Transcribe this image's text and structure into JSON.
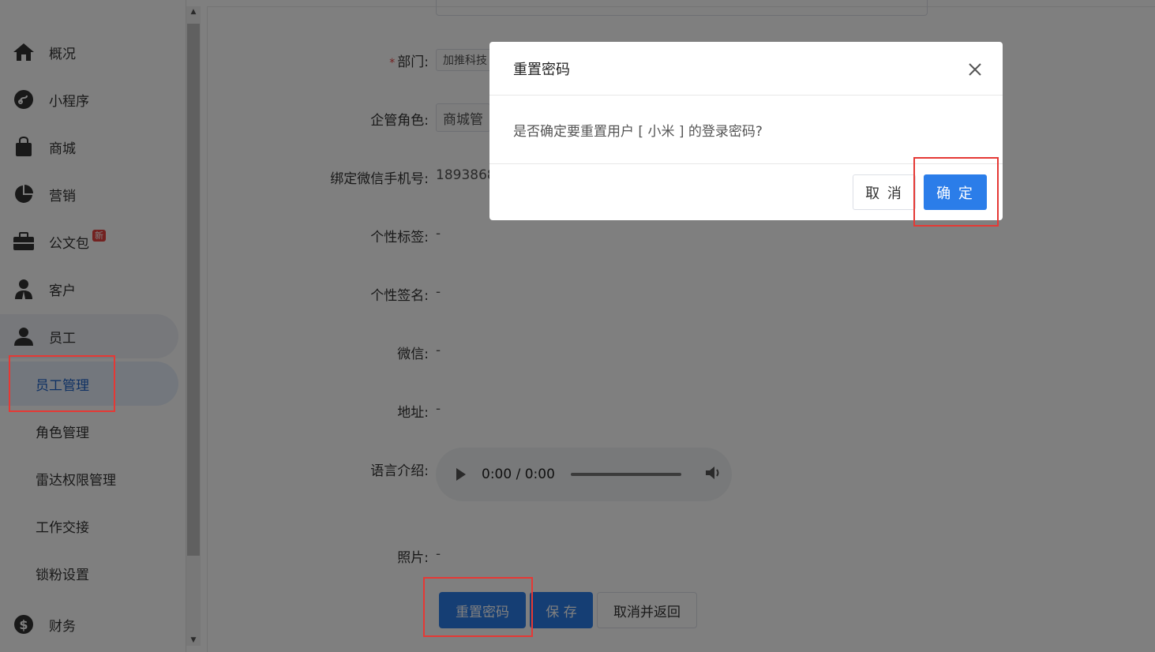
{
  "sidebar": {
    "items": [
      {
        "label": "概况",
        "icon": "home-icon"
      },
      {
        "label": "小程序",
        "icon": "mini-program-icon"
      },
      {
        "label": "商城",
        "icon": "shopping-bag-icon"
      },
      {
        "label": "营销",
        "icon": "pie-chart-icon"
      },
      {
        "label": "公文包",
        "icon": "briefcase-icon",
        "badge": "新"
      },
      {
        "label": "客户",
        "icon": "customer-icon"
      },
      {
        "label": "员工",
        "icon": "user-icon"
      }
    ],
    "sub_items": [
      "员工管理",
      "角色管理",
      "雷达权限管理",
      "工作交接",
      "锁粉设置"
    ],
    "finance": {
      "label": "财务",
      "icon": "dollar-icon"
    }
  },
  "form": {
    "dept_label": "部门:",
    "dept_value": "加推科技",
    "role_label": "企管角色:",
    "role_value": "商城管",
    "phone_label": "绑定微信手机号:",
    "phone_value": "1893868",
    "tag_label": "个性标签:",
    "tag_value": "-",
    "sign_label": "个性签名:",
    "sign_value": "-",
    "wechat_label": "微信:",
    "wechat_value": "-",
    "address_label": "地址:",
    "address_value": "-",
    "voice_label": "语言介绍:",
    "audio_time": "0:00 / 0:00",
    "photo_label": "照片:",
    "photo_value": "-"
  },
  "actions": {
    "reset": "重置密码",
    "save": "保 存",
    "cancel": "取消并返回"
  },
  "modal": {
    "title": "重置密码",
    "message": "是否确定要重置用户 [ 小米 ] 的登录密码?",
    "cancel": "取 消",
    "ok": "确 定"
  },
  "colors": {
    "primary": "#2b7de9",
    "highlight": "#e53935",
    "badge": "#e64340"
  }
}
